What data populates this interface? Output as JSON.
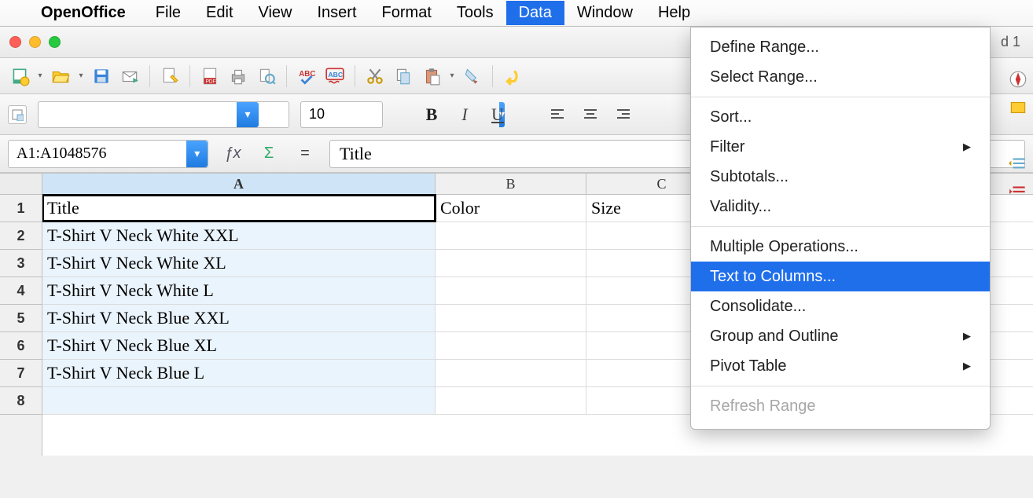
{
  "menubar": {
    "apple": "",
    "app": "OpenOffice",
    "items": [
      "File",
      "Edit",
      "View",
      "Insert",
      "Format",
      "Tools",
      "Data",
      "Window",
      "Help"
    ],
    "active": "Data"
  },
  "window": {
    "title_right": "d 1"
  },
  "formatting": {
    "font_name": "",
    "font_size": "10",
    "bold": "B",
    "italic": "I",
    "underline": "U"
  },
  "formula_bar": {
    "name_box": "A1:A1048576",
    "fx": "ƒx",
    "sigma": "Σ",
    "eq": "=",
    "value": "Title"
  },
  "sheet": {
    "columns": [
      "A",
      "B",
      "C"
    ],
    "selected_column": "A",
    "rows": [
      {
        "n": "1",
        "A": "Title",
        "B": "Color",
        "C": "Size"
      },
      {
        "n": "2",
        "A": "T-Shirt V Neck White XXL",
        "B": "",
        "C": ""
      },
      {
        "n": "3",
        "A": "T-Shirt V Neck White XL",
        "B": "",
        "C": ""
      },
      {
        "n": "4",
        "A": "T-Shirt V Neck White L",
        "B": "",
        "C": ""
      },
      {
        "n": "5",
        "A": "T-Shirt V Neck Blue XXL",
        "B": "",
        "C": ""
      },
      {
        "n": "6",
        "A": "T-Shirt V Neck Blue XL",
        "B": "",
        "C": ""
      },
      {
        "n": "7",
        "A": "T-Shirt V Neck Blue L",
        "B": "",
        "C": ""
      },
      {
        "n": "8",
        "A": "",
        "B": "",
        "C": ""
      }
    ],
    "cursor": {
      "row": 1,
      "col": "A"
    }
  },
  "data_menu": {
    "items": [
      {
        "label": "Define Range...",
        "type": "item"
      },
      {
        "label": "Select Range...",
        "type": "item"
      },
      {
        "type": "sep"
      },
      {
        "label": "Sort...",
        "type": "item"
      },
      {
        "label": "Filter",
        "type": "sub"
      },
      {
        "label": "Subtotals...",
        "type": "item"
      },
      {
        "label": "Validity...",
        "type": "item"
      },
      {
        "type": "sep"
      },
      {
        "label": "Multiple Operations...",
        "type": "item"
      },
      {
        "label": "Text to Columns...",
        "type": "item",
        "highlight": true
      },
      {
        "label": "Consolidate...",
        "type": "item"
      },
      {
        "label": "Group and Outline",
        "type": "sub"
      },
      {
        "label": "Pivot Table",
        "type": "sub"
      },
      {
        "type": "sep"
      },
      {
        "label": "Refresh Range",
        "type": "item",
        "disabled": true
      }
    ]
  },
  "align_icons": {
    "indent_dec": "⇤",
    "indent_inc": "⇥"
  }
}
